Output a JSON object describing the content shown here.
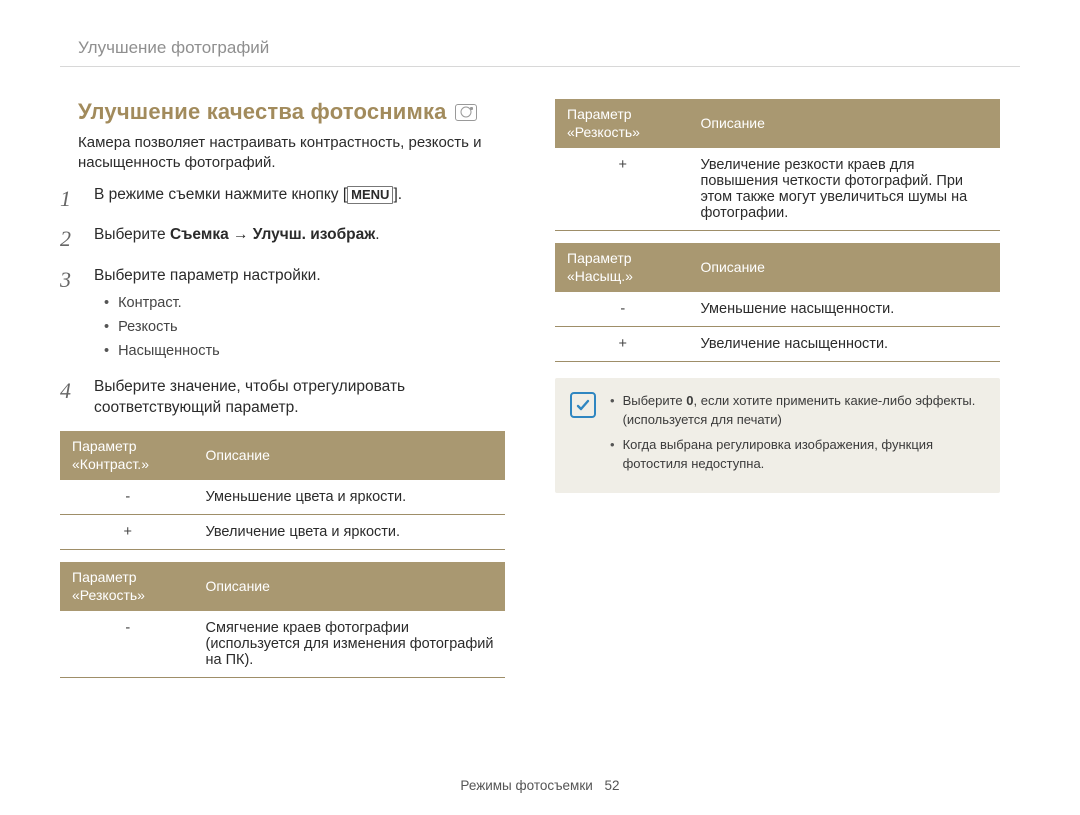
{
  "breadcrumb": "Улучшение фотографий",
  "title": "Улучшение качества фотоснимка",
  "intro": "Камера позволяет настраивать контрастность, резкость и насыщенность фотографий.",
  "steps": {
    "s1_pre": "В режиме съемки нажмите кнопку [",
    "s1_btn": "MENU",
    "s1_post": "].",
    "s2_pre": "Выберите ",
    "s2_bold": "Съемка → Улучш. изображ",
    "s2_post": ".",
    "s3": "Выберите параметр настройки.",
    "s3_items": {
      "a": "Контраст.",
      "b": "Резкость",
      "c": "Насыщенность"
    },
    "s4": "Выберите значение, чтобы отрегулировать соответствующий параметр."
  },
  "tables": {
    "contrast": {
      "h1": "Параметр «Контраст.»",
      "h2": "Описание",
      "rows": {
        "r1p": "-",
        "r1d": "Уменьшение цвета и яркости.",
        "r2p": "+",
        "r2d": "Увеличение цвета и яркости."
      }
    },
    "sharpness_left": {
      "h1": "Параметр «Резкость»",
      "h2": "Описание",
      "rows": {
        "r1p": "-",
        "r1d": "Смягчение краев фотографии (используется для изменения фотографий на ПК)."
      }
    },
    "sharpness_right": {
      "h1": "Параметр «Резкость»",
      "h2": "Описание",
      "rows": {
        "r1p": "+",
        "r1d": "Увеличение резкости краев для повышения четкости фотографий. При этом также могут увеличиться шумы на фотографии."
      }
    },
    "saturation": {
      "h1": "Параметр «Насыщ.»",
      "h2": "Описание",
      "rows": {
        "r1p": "-",
        "r1d": "Уменьшение насыщенности.",
        "r2p": "+",
        "r2d": "Увеличение насыщенности."
      }
    }
  },
  "notes": {
    "n1_pre": "Выберите ",
    "n1_bold": "0",
    "n1_post": ", если хотите применить какие-либо эффекты. (используется для печати)",
    "n2": "Когда выбрана регулировка изображения, функция фотостиля недоступна."
  },
  "footer": {
    "section": "Режимы фотосъемки",
    "page": "52"
  }
}
